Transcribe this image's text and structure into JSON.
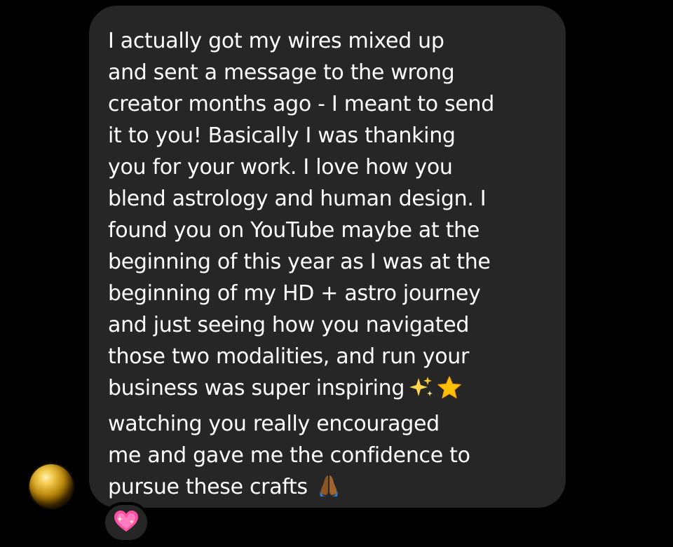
{
  "message": {
    "lines": [
      "I actually got my wires mixed up",
      "and sent a message to the wrong",
      "creator months ago - I meant to send",
      "it to you! Basically I was thanking",
      "you for your work. I love how you",
      "blend astrology and human design. I",
      "found you on YouTube maybe at the",
      "beginning of this year as I was at the",
      "beginning of my HD + astro journey",
      "and just seeing how you navigated",
      "those two modalities, and run your",
      "business was super inspiring",
      "watching you really encouraged",
      "me and gave me the confidence to",
      "pursue these crafts"
    ],
    "emojis": {
      "line_12": [
        "sparkles-emoji",
        "star-emoji"
      ],
      "line_15": [
        "folded-hands-emoji"
      ]
    }
  },
  "avatar": {
    "icon": "gold-orb-avatar"
  },
  "reaction": {
    "icon": "sparkling-heart-emoji"
  },
  "colors": {
    "background": "#000000",
    "bubble": "#262626",
    "text": "#ffffff"
  }
}
